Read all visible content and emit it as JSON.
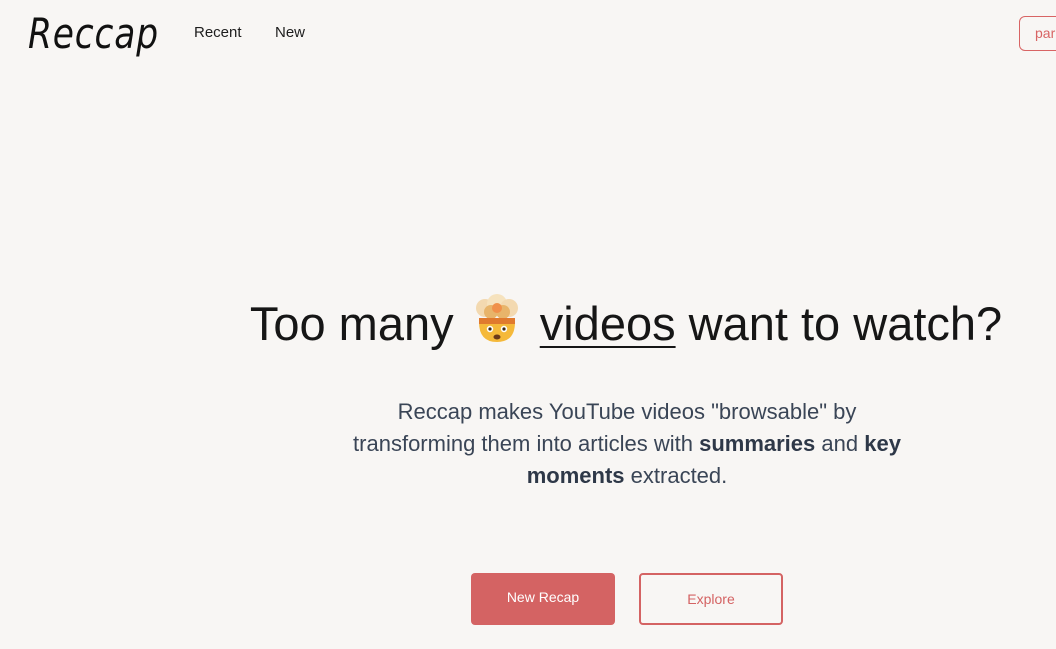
{
  "header": {
    "logo_text": "Reccap",
    "nav": {
      "recent_label": "Recent",
      "new_label": "New"
    },
    "right_button_label": "par"
  },
  "hero": {
    "title_part1": "Too many",
    "emoji_icon": "exploding-head-icon",
    "title_underlined": "videos",
    "title_part2": "want to watch?",
    "subtitle": {
      "part1": "Reccap makes YouTube videos \"browsable\" by transforming them into articles with",
      "bold1": "summaries",
      "part2": "and",
      "bold2": "key moments",
      "part3": "extracted."
    },
    "primary_button_label": "New Recap",
    "secondary_button_label": "Explore"
  },
  "colors": {
    "background": "#f8f6f4",
    "accent": "#d46363",
    "text": "#161616",
    "subtext": "#3a4556"
  }
}
